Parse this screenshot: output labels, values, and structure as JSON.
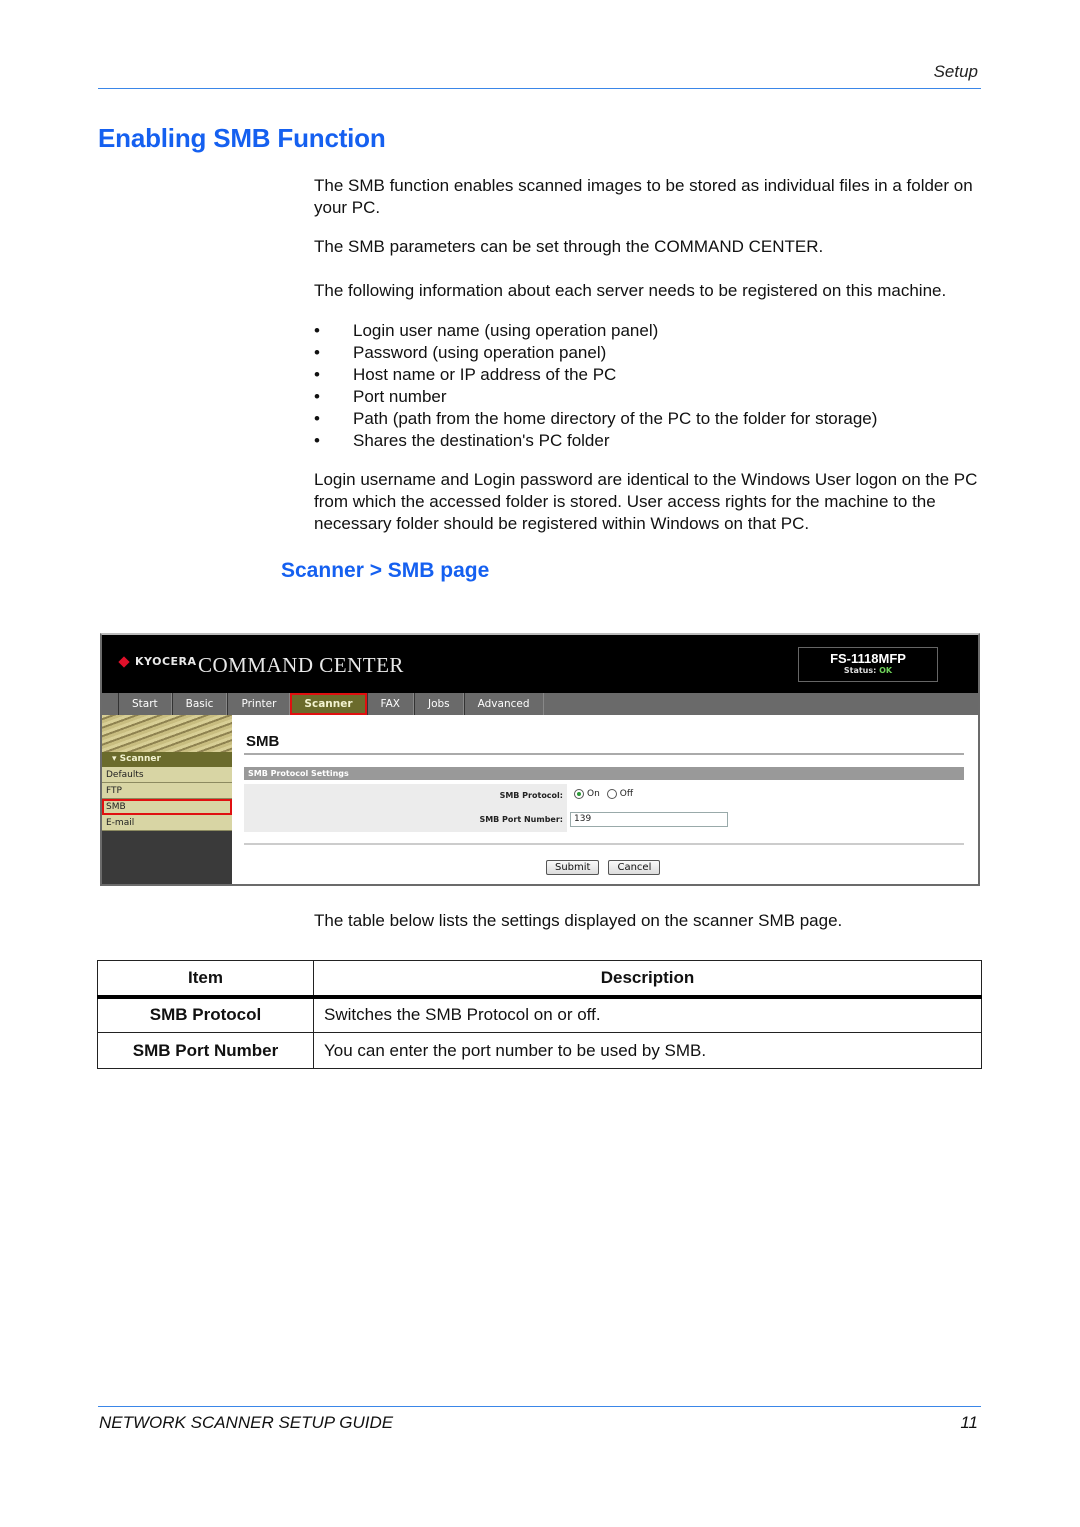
{
  "header": {
    "section": "Setup"
  },
  "title": "Enabling SMB Function",
  "paragraphs": {
    "p1": "The SMB function enables scanned images to be stored as individual files in a folder on your PC.",
    "p2": "The SMB parameters can be set through the COMMAND CENTER.",
    "p3": "The following information about each server needs to be registered on this machine.",
    "p4": "Login username and Login password are identical to the Windows User logon on the PC from which the accessed folder is stored. User access rights for the machine to the necessary folder should be registered within Windows on that PC."
  },
  "bullet_glyph": "•",
  "bullets": [
    "Login user name (using operation panel)",
    "Password (using operation panel)",
    "Host name or IP address of the PC",
    "Port number",
    "Path (path from the home directory of the PC to the folder for storage)",
    "Shares the destination's PC folder"
  ],
  "subheading": "Scanner > SMB page",
  "command_center": {
    "brand": "KYOCERA",
    "app_title": "COMMAND CENTER",
    "model": "FS-1118MFP",
    "status_label": "Status:",
    "status_value": "OK",
    "tabs": [
      {
        "label": "Start",
        "active": false
      },
      {
        "label": "Basic",
        "active": false
      },
      {
        "label": "Printer",
        "active": false
      },
      {
        "label": "Scanner",
        "active": true
      },
      {
        "label": "FAX",
        "active": false
      },
      {
        "label": "Jobs",
        "active": false
      },
      {
        "label": "Advanced",
        "active": false
      }
    ],
    "sidebar": {
      "section": "Scanner",
      "items": [
        {
          "label": "Defaults",
          "active": false
        },
        {
          "label": "FTP",
          "active": false
        },
        {
          "label": "SMB",
          "active": true
        },
        {
          "label": "E-mail",
          "active": false
        }
      ]
    },
    "page_heading": "SMB",
    "settings_bar": "SMB Protocol Settings",
    "fields": {
      "protocol_label": "SMB Protocol:",
      "protocol_on": "On",
      "protocol_off": "Off",
      "protocol_value": "On",
      "port_label": "SMB Port Number:",
      "port_value": "139"
    },
    "buttons": {
      "submit": "Submit",
      "cancel": "Cancel"
    },
    "highlight_color": "#e01010",
    "status_ok_color": "#6fd25a"
  },
  "caption": "The table below lists the settings displayed on the scanner SMB page.",
  "table": {
    "headers": [
      "Item",
      "Description"
    ],
    "rows": [
      {
        "item": "SMB Protocol",
        "description": "Switches the SMB Protocol on or off."
      },
      {
        "item": "SMB Port Number",
        "description": "You can enter the port number to be used by SMB."
      }
    ]
  },
  "footer": {
    "guide": "NETWORK SCANNER SETUP GUIDE",
    "page": "11"
  },
  "colors": {
    "heading_blue": "#1560f0",
    "rule_blue": "#3a86e8"
  }
}
